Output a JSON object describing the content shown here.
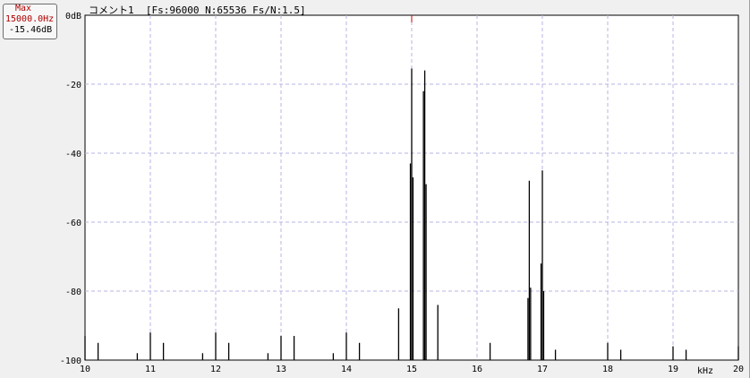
{
  "max_box": {
    "label": "Max",
    "freq": "15000.0Hz",
    "level": "-15.46dB"
  },
  "header": {
    "comment": "コメント1  [Fs:96000 N:65536 Fs/N:1.5]"
  },
  "chart_data": {
    "type": "line",
    "title": "",
    "xlabel": "kHz",
    "ylabel": "",
    "xlim": [
      10,
      20
    ],
    "ylim": [
      -100,
      0
    ],
    "x_ticks": [
      "10",
      "11",
      "12",
      "13",
      "14",
      "15",
      "16",
      "17",
      "18",
      "19",
      "20"
    ],
    "y_ticks": [
      "0dB",
      "-20",
      "-40",
      "-60",
      "-80",
      "-100"
    ],
    "grid": true,
    "marker_x": 15.0,
    "series": [
      {
        "color": "#000000",
        "peaks": [
          {
            "x": 10.0,
            "y": -93
          },
          {
            "x": 10.2,
            "y": -95
          },
          {
            "x": 10.8,
            "y": -98
          },
          {
            "x": 11.0,
            "y": -92
          },
          {
            "x": 11.2,
            "y": -95
          },
          {
            "x": 11.8,
            "y": -98
          },
          {
            "x": 12.0,
            "y": -92
          },
          {
            "x": 12.2,
            "y": -95
          },
          {
            "x": 12.8,
            "y": -98
          },
          {
            "x": 13.0,
            "y": -93
          },
          {
            "x": 13.2,
            "y": -93
          },
          {
            "x": 13.8,
            "y": -98
          },
          {
            "x": 14.0,
            "y": -92
          },
          {
            "x": 14.2,
            "y": -95
          },
          {
            "x": 14.8,
            "y": -85
          },
          {
            "x": 14.98,
            "y": -43
          },
          {
            "x": 15.0,
            "y": -15.46
          },
          {
            "x": 15.02,
            "y": -47
          },
          {
            "x": 15.18,
            "y": -22
          },
          {
            "x": 15.2,
            "y": -16
          },
          {
            "x": 15.22,
            "y": -49
          },
          {
            "x": 15.4,
            "y": -84
          },
          {
            "x": 16.2,
            "y": -95
          },
          {
            "x": 16.78,
            "y": -82
          },
          {
            "x": 16.8,
            "y": -48
          },
          {
            "x": 16.82,
            "y": -79
          },
          {
            "x": 16.98,
            "y": -72
          },
          {
            "x": 17.0,
            "y": -45
          },
          {
            "x": 17.02,
            "y": -80
          },
          {
            "x": 17.2,
            "y": -97
          },
          {
            "x": 18.0,
            "y": -95
          },
          {
            "x": 18.2,
            "y": -97
          },
          {
            "x": 19.0,
            "y": -96
          },
          {
            "x": 19.2,
            "y": -97
          },
          {
            "x": 20.0,
            "y": -96
          }
        ]
      }
    ]
  }
}
